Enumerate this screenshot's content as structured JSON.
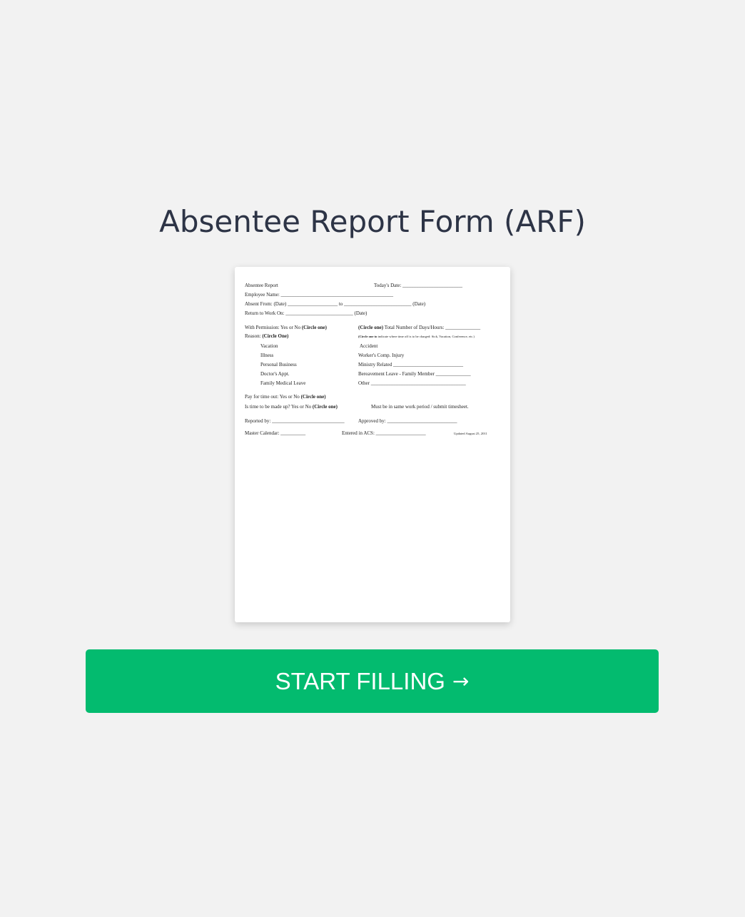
{
  "page": {
    "title": "Absentee Report Form (ARF)"
  },
  "form_preview": {
    "lines": [
      "Absentee Report",
      "Today's Date: ________________________",
      "Employee Name: _____________________________________________",
      "Absent From: (Date) ____________________ to ___________________________ (Date)",
      "Return to Work On: ___________________________ (Date)",
      "With Permission:  Yes   or   No",
      "(Circle one)",
      "(Circle one)",
      "Total Number of Days/Hours: ______________",
      "Reason:",
      "(Circle One)",
      "(Circle one to",
      "indicate where time off is to be charged: Sick, Vacation, Conference, etc.)",
      "Vacation",
      "Accident",
      "Illness",
      "Worker's Comp. Injury",
      "Personal Business",
      "Ministry Related ____________________________",
      "Doctor's Appt.",
      "Bereavement Leave - Family Member ______________",
      "Family Medical Leave",
      "Other ______________________________________",
      "Pay for time out:          Yes    or    No",
      "(Circle one)",
      "Is time to be made up?          Yes    or    No",
      "(Circle one)",
      "Must be in same work period / submit timesheet.",
      "Reported by: _____________________________",
      "Approved by: ____________________________",
      "Master Calendar: __________",
      "Entered in ACS: ____________________",
      "Updated August 25, 2011"
    ]
  },
  "cta": {
    "label": "START FILLING",
    "arrow": "→",
    "color": "#03bb6f"
  }
}
